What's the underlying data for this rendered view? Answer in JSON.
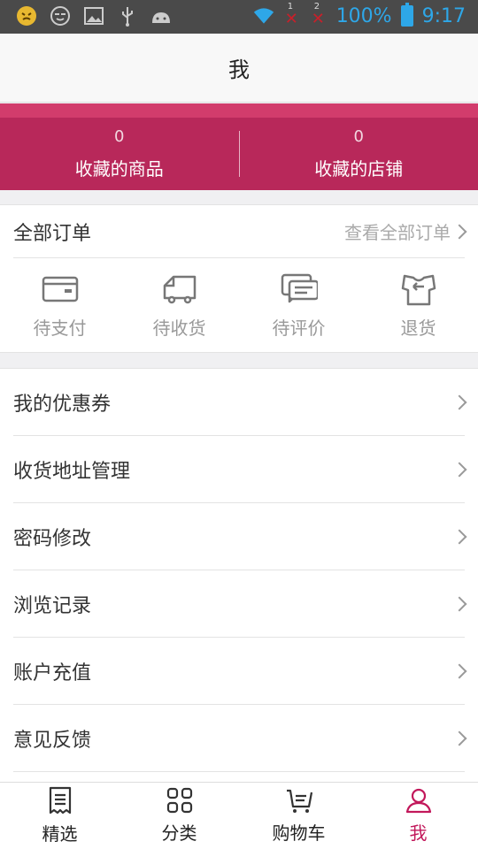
{
  "statusbar": {
    "left_icons": [
      "emoji-icon",
      "face-icon",
      "image-icon",
      "usb-icon",
      "android-icon"
    ],
    "sim1": "1",
    "sim2": "2",
    "battery": "100%",
    "time": "9:17"
  },
  "title": "我",
  "favorites": [
    {
      "count": "0",
      "label": "收藏的商品"
    },
    {
      "count": "0",
      "label": "收藏的店铺"
    }
  ],
  "orders": {
    "title": "全部订单",
    "view_all": "查看全部订单",
    "statuses": [
      {
        "label": "待支付",
        "icon": "wallet-icon"
      },
      {
        "label": "待收货",
        "icon": "truck-icon"
      },
      {
        "label": "待评价",
        "icon": "comment-icon"
      },
      {
        "label": "退货",
        "icon": "return-shirt-icon"
      }
    ]
  },
  "menu": [
    {
      "label": "我的优惠券"
    },
    {
      "label": "收货地址管理"
    },
    {
      "label": "密码修改"
    },
    {
      "label": "浏览记录"
    },
    {
      "label": "账户充值"
    },
    {
      "label": "意见反馈"
    }
  ],
  "tabs": [
    {
      "label": "精选",
      "icon": "receipt-icon"
    },
    {
      "label": "分类",
      "icon": "grid-icon"
    },
    {
      "label": "购物车",
      "icon": "cart-icon"
    },
    {
      "label": "我",
      "icon": "person-icon",
      "active": true
    }
  ],
  "colors": {
    "accent": "#c2185b",
    "band": "#b8285a",
    "band_top": "#d23c6c",
    "status_blue": "#2ea7e8"
  }
}
